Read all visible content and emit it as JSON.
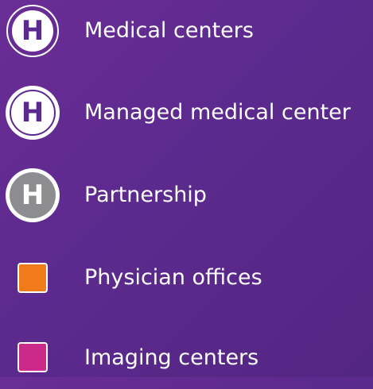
{
  "legend": {
    "items": [
      {
        "label": "Medical centers",
        "icon": "hospital-outline-icon",
        "glyph": "H"
      },
      {
        "label": "Managed medical center",
        "icon": "hospital-solid-icon",
        "glyph": "H"
      },
      {
        "label": "Partnership",
        "icon": "hospital-grey-icon",
        "glyph": "H"
      },
      {
        "label": "Physician offices",
        "icon": "orange-square-icon",
        "color": "#f07b1a"
      },
      {
        "label": "Imaging centers",
        "icon": "magenta-square-icon",
        "color": "#cc2a8a"
      }
    ]
  },
  "colors": {
    "background": "#5c2a8e",
    "text": "#ffffff",
    "partnership_grey": "#8d8d8f"
  }
}
